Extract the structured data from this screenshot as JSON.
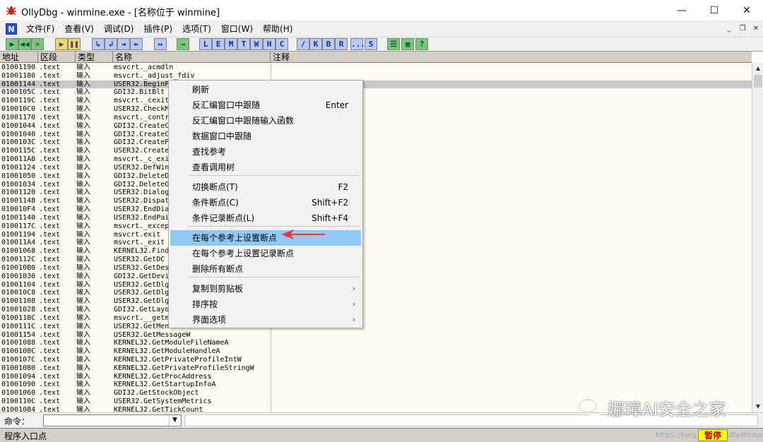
{
  "window": {
    "title": "OllyDbg - winmine.exe - [名称位于 winmine]",
    "minimize_icon": "—",
    "maximize_icon": "☐",
    "close_icon": "✕"
  },
  "menubar": {
    "mdi_icon_label": "N",
    "items": [
      "文件(F)",
      "查看(V)",
      "调试(D)",
      "插件(P)",
      "选项(T)",
      "窗口(W)",
      "帮助(H)"
    ],
    "mdi_minimize": "_",
    "mdi_restore": "❐",
    "mdi_close": "✕"
  },
  "toolbar": {
    "buttons": [
      "▶",
      "◀◀",
      "✕",
      "▶",
      "❚❚",
      "↳",
      "↲",
      "⇥",
      "⇤",
      "↦",
      "→",
      "L",
      "E",
      "M",
      "T",
      "W",
      "H",
      "C",
      "/",
      "K",
      "B",
      "R",
      "...",
      "S",
      "☰",
      "▦",
      "?"
    ]
  },
  "table": {
    "headers": {
      "addr": "地址",
      "seg": "区段",
      "type": "类型",
      "name": "名称",
      "comment": "注释"
    },
    "rows": [
      [
        "01001190",
        ".text",
        "输入",
        "msvcrt._acmdln"
      ],
      [
        "01001180",
        ".text",
        "输入",
        "msvcrt._adjust_fdiv"
      ],
      [
        "01001144",
        ".text",
        "输入",
        "USER32.BeginP"
      ],
      [
        "0100105C",
        ".text",
        "输入",
        "GDI32.BitBlt"
      ],
      [
        "0100119C",
        ".text",
        "输入",
        "msvcrt._cexit"
      ],
      [
        "010010C0",
        ".text",
        "输入",
        "USER32.CheckM"
      ],
      [
        "01001170",
        ".text",
        "输入",
        "msvcrt._contr"
      ],
      [
        "01001044",
        ".text",
        "输入",
        "GDI32.CreateC"
      ],
      [
        "01001040",
        ".text",
        "输入",
        "GDI32.CreateC"
      ],
      [
        "0100103C",
        ".text",
        "输入",
        "GDI32.CreateP"
      ],
      [
        "0100115C",
        ".text",
        "输入",
        "USER32.Create"
      ],
      [
        "010011A8",
        ".text",
        "输入",
        "msvcrt._c_exi"
      ],
      [
        "01001124",
        ".text",
        "输入",
        "USER32.DefWin"
      ],
      [
        "01001050",
        ".text",
        "输入",
        "GDI32.DeleteD"
      ],
      [
        "01001034",
        ".text",
        "输入",
        "GDI32.DeleteO"
      ],
      [
        "01001120",
        ".text",
        "输入",
        "USER32.Dialog"
      ],
      [
        "01001148",
        ".text",
        "输入",
        "USER32.Dispat"
      ],
      [
        "010010F4",
        ".text",
        "输入",
        "USER32.EndDia"
      ],
      [
        "01001140",
        ".text",
        "输入",
        "USER32.EndPai"
      ],
      [
        "0100117C",
        ".text",
        "输入",
        "msvcrt._excep"
      ],
      [
        "01001194",
        ".text",
        "输入",
        "msvcrt.exit"
      ],
      [
        "010011A4",
        ".text",
        "输入",
        "msvcrt._exit"
      ],
      [
        "01001068",
        ".text",
        "输入",
        "KERNEL32.Find"
      ],
      [
        "0100112C",
        ".text",
        "输入",
        "USER32.GetDC"
      ],
      [
        "010010B0",
        ".text",
        "输入",
        "USER32.GetDes"
      ],
      [
        "01001030",
        ".text",
        "输入",
        "GDI32.GetDevi"
      ],
      [
        "01001104",
        ".text",
        "输入",
        "USER32.GetDlg"
      ],
      [
        "010010C8",
        ".text",
        "输入",
        "USER32.GetDlg"
      ],
      [
        "01001108",
        ".text",
        "输入",
        "USER32.GetDlg"
      ],
      [
        "01001028",
        ".text",
        "输入",
        "GDI32.GetLayo"
      ],
      [
        "0100118C",
        ".text",
        "输入",
        "msvcrt.__getm"
      ],
      [
        "0100111C",
        ".text",
        "输入",
        "USER32.GetMen"
      ],
      [
        "01001154",
        ".text",
        "输入",
        "USER32.GetMessageW"
      ],
      [
        "01001088",
        ".text",
        "输入",
        "KERNEL32.GetModuleFileNameA"
      ],
      [
        "0100108C",
        ".text",
        "输入",
        "KERNEL32.GetModuleHandleA"
      ],
      [
        "0100107C",
        ".text",
        "输入",
        "KERNEL32.GetPrivateProfileIntW"
      ],
      [
        "01001080",
        ".text",
        "输入",
        "KERNEL32.GetPrivateProfileStringW"
      ],
      [
        "01001094",
        ".text",
        "输入",
        "KERNEL32.GetProcAddress"
      ],
      [
        "01001090",
        ".text",
        "输入",
        "KERNEL32.GetStartupInfoA"
      ],
      [
        "01001060",
        ".text",
        "输入",
        "GDI32.GetStockObject"
      ],
      [
        "0100110C",
        ".text",
        "输入",
        "USER32.GetSystemMetrics"
      ],
      [
        "01001084",
        ".text",
        "输入",
        "KERNEL32.GetTickCount"
      ]
    ]
  },
  "context_menu": {
    "items": [
      {
        "label": "刷新",
        "shortcut": ""
      },
      {
        "label": "反汇编窗口中跟随",
        "shortcut": "Enter"
      },
      {
        "label": "反汇编窗口中跟随输入函数",
        "shortcut": ""
      },
      {
        "label": "数据窗口中跟随",
        "shortcut": ""
      },
      {
        "label": "查找参考",
        "shortcut": ""
      },
      {
        "label": "查看调用树",
        "shortcut": ""
      },
      {
        "label": "切换断点(T)",
        "shortcut": "F2"
      },
      {
        "label": "条件断点(C)",
        "shortcut": "Shift+F2"
      },
      {
        "label": "条件记录断点(L)",
        "shortcut": "Shift+F4"
      },
      {
        "label": "在每个参考上设置断点",
        "shortcut": ""
      },
      {
        "label": "在每个参考上设置记录断点",
        "shortcut": ""
      },
      {
        "label": "删除所有断点",
        "shortcut": ""
      },
      {
        "label": "复制到剪贴板",
        "shortcut": ""
      },
      {
        "label": "排序按",
        "shortcut": ""
      },
      {
        "label": "界面选项",
        "shortcut": ""
      }
    ],
    "submenu_arrow": "›",
    "highlighted_index": 9
  },
  "command_bar": {
    "label": "命令：",
    "dropdown_icon": "▼"
  },
  "status_bar": {
    "text": "程序入口点",
    "state": "暂停",
    "url": "https://blog.csdn.net/Eastmount"
  },
  "watermark": {
    "text": "娜璋AI安全之家"
  },
  "colors": {
    "highlight": "#91c9f7",
    "table_bg": "#fffbf0",
    "paused_bg": "#ffff00",
    "paused_fg": "#c00000",
    "annotation_arrow": "#e23b3b"
  }
}
